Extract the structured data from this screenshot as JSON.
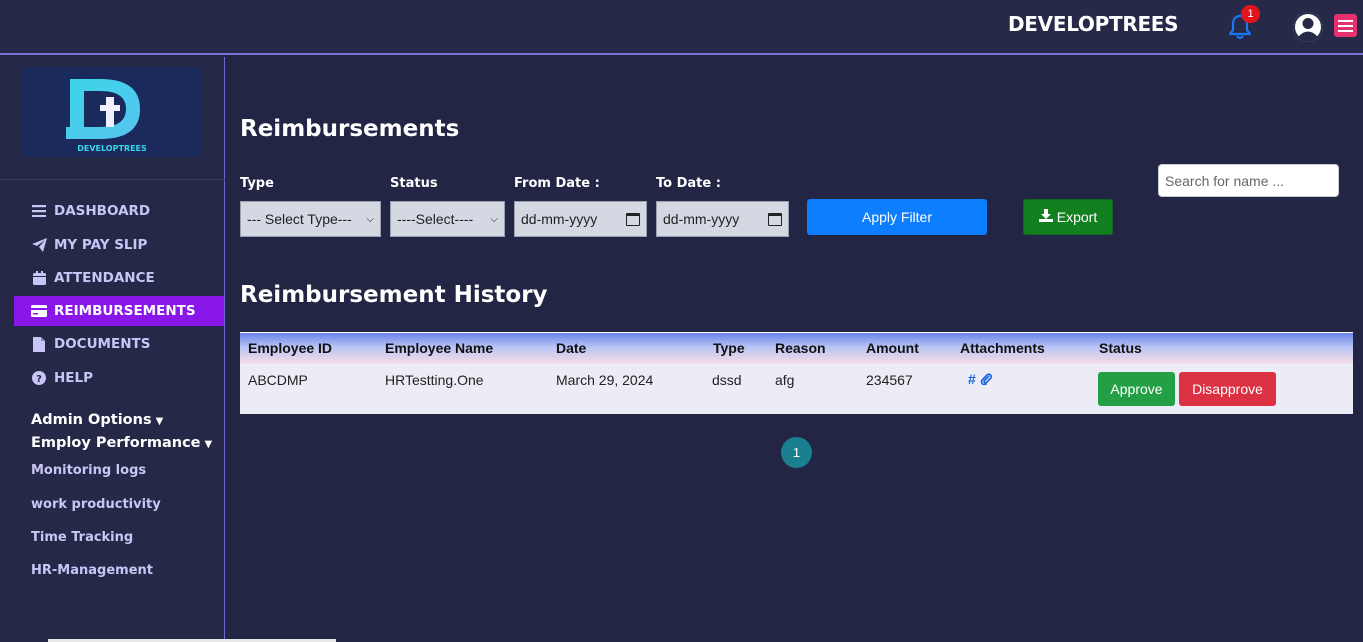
{
  "header": {
    "brand": "DEVELOPTREES",
    "notification_count": "1",
    "notification_icon": "bell-icon",
    "user_icon": "user-circle-icon",
    "menu_icon": "hamburger-icon"
  },
  "sidebar": {
    "logo_text": "DEVELOPTREES",
    "nav": [
      {
        "label": "DASHBOARD",
        "icon": "list-icon"
      },
      {
        "label": "MY PAY SLIP",
        "icon": "paper-plane-icon"
      },
      {
        "label": "ATTENDANCE",
        "icon": "calendar-icon"
      },
      {
        "label": "REIMBURSEMENTS",
        "icon": "credit-card-icon",
        "active": true
      },
      {
        "label": "DOCUMENTS",
        "icon": "file-icon"
      },
      {
        "label": "HELP",
        "icon": "question-circle-icon"
      }
    ],
    "admin_options": "Admin Options",
    "employ_performance": "Employ Performance",
    "links": [
      "Monitoring logs",
      "work productivity",
      "Time Tracking",
      "HR-Management"
    ]
  },
  "main": {
    "title": "Reimbursements",
    "filters": {
      "type_label": "Type",
      "type_value": "--- Select Type---",
      "status_label": "Status",
      "status_value": "----Select----",
      "from_label": "From Date :",
      "from_placeholder": "dd-mm-yyyy",
      "to_label": "To Date :",
      "to_placeholder": "dd-mm-yyyy",
      "apply": "Apply Filter",
      "export": "Export"
    },
    "search_placeholder": "Search for name ...",
    "history_title": "Reimbursement History",
    "table": {
      "columns": [
        "Employee ID",
        "Employee Name",
        "Date",
        "Type",
        "Reason",
        "Amount",
        "Attachments",
        "Status"
      ],
      "rows": [
        {
          "employee_id": "ABCDMP",
          "employee_name": "HRTestting.One",
          "date": "March 29, 2024",
          "type": "dssd",
          "reason": "afg",
          "amount": "234567",
          "attachment": "#",
          "approve": "Approve",
          "disapprove": "Disapprove"
        }
      ]
    },
    "pagination": {
      "current": "1"
    }
  },
  "colors": {
    "background": "#222544",
    "active_nav": "#8a17ea",
    "apply": "#0d7efd",
    "export": "#13801f",
    "approve": "#23a046",
    "disapprove": "#dc3043",
    "page": "#1a7f8e"
  }
}
